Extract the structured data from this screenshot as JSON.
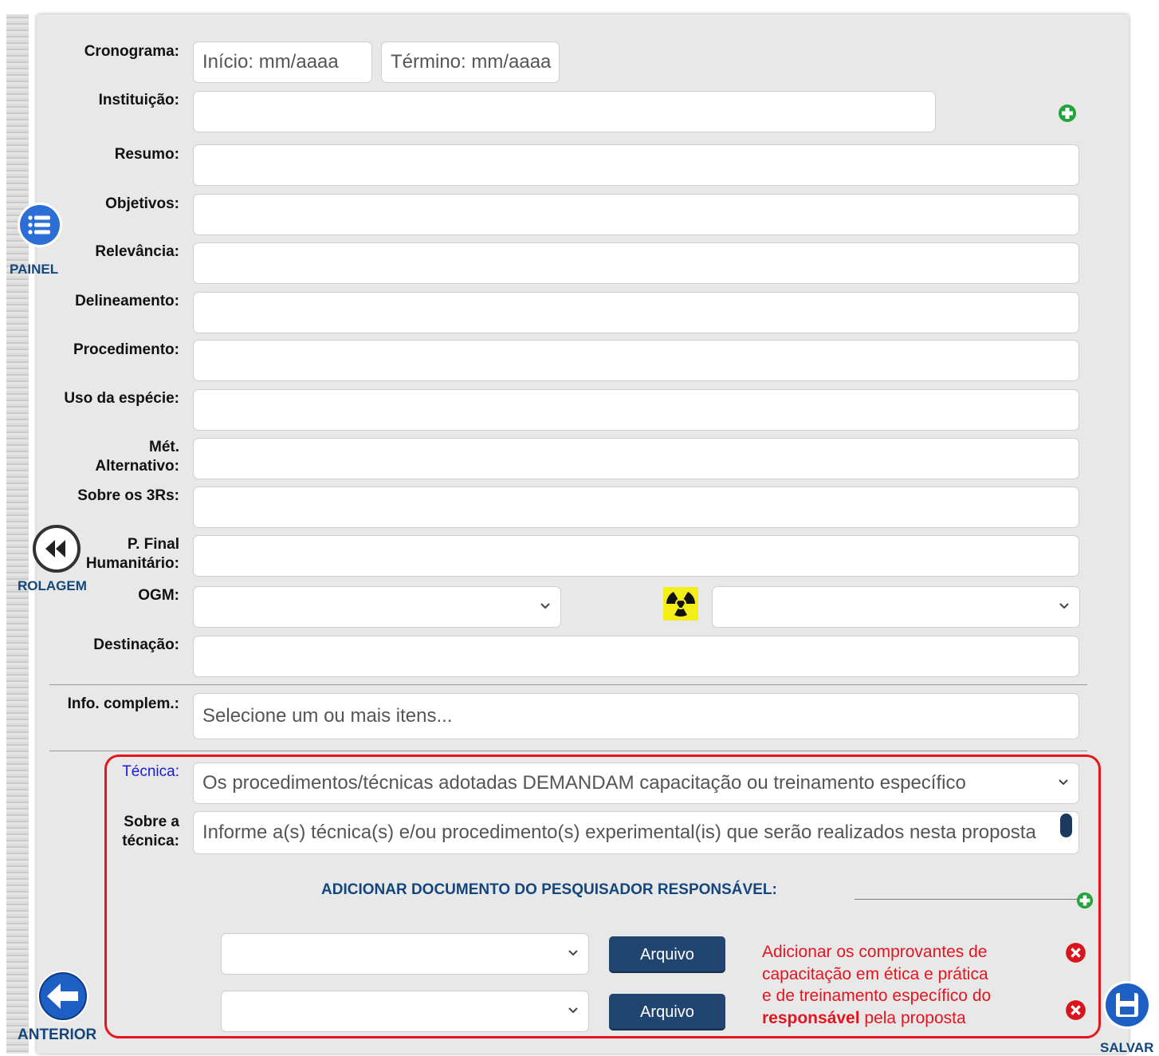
{
  "form": {
    "cronograma_label": "Cronograma:",
    "inicio_placeholder": "Início: mm/aaaa",
    "termino_placeholder": "Término: mm/aaaa",
    "instituicao_label": "Instituição:",
    "resumo_label": "Resumo:",
    "objetivos_label": "Objetivos:",
    "relevancia_label": "Relevância:",
    "delineamento_label": "Delineamento:",
    "procedimento_label": "Procedimento:",
    "uso_especie_label": "Uso da espécie:",
    "met_alt_label_1": "Mét.",
    "met_alt_label_2": "Alternativo:",
    "sobre_3rs_label": "Sobre os 3Rs:",
    "pfinal_label_1": "P. Final",
    "pfinal_label_2": "Humanitário:",
    "ogm_label": "OGM:",
    "destinacao_label": "Destinação:",
    "info_label": "Info. complem.:",
    "info_placeholder": "Selecione um ou mais itens...",
    "tecnica_label": "Técnica:",
    "tecnica_value": "Os procedimentos/técnicas adotadas DEMANDAM capacitação ou treinamento específico",
    "sobre_tecnica_label_1": "Sobre a",
    "sobre_tecnica_label_2": "técnica:",
    "sobre_tecnica_placeholder": "Informe a(s) técnica(s) e/ou procedimento(s) experimental(is) que serão realizados nesta proposta"
  },
  "docs": {
    "add_label": "ADICIONAR DOCUMENTO DO PESQUISADOR RESPONSÁVEL:",
    "arquivo_1": "Arquivo",
    "arquivo_2": "Arquivo",
    "note_line1": "Adicionar os comprovantes de",
    "note_line2": "capacitação em ética e prática",
    "note_line3": "e de treinamento específico do",
    "note_bold": "responsável",
    "note_tail": " pela proposta"
  },
  "sidebar": {
    "painel": "PAINEL",
    "rolagem": "ROLAGEM",
    "anterior": "ANTERIOR",
    "salvar": "SALVAR"
  },
  "colors": {
    "accent_navy": "#1f4570",
    "highlight_red": "#e5141f",
    "add_green": "#22a33b",
    "radiation_yellow": "#f4ee18"
  }
}
